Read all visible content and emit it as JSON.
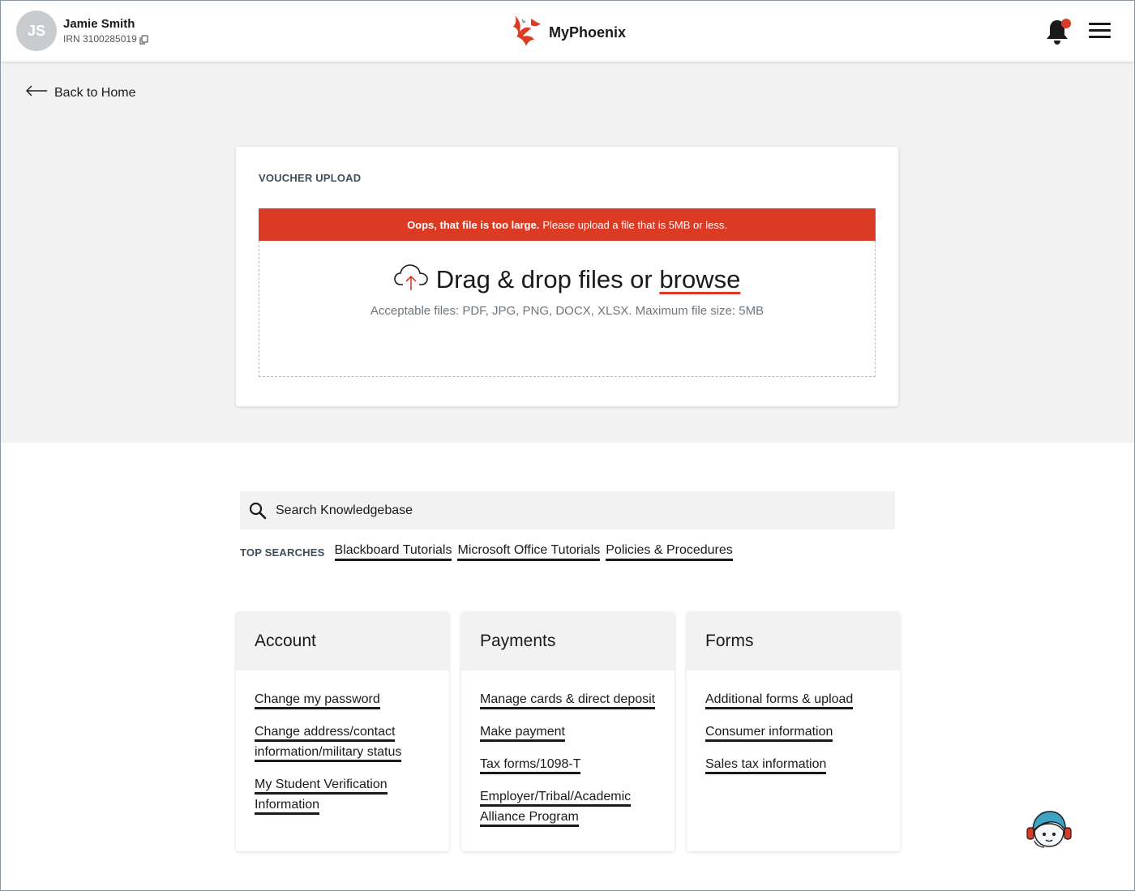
{
  "header": {
    "avatar_initials": "JS",
    "user_name": "Jamie Smith",
    "irn": "IRN 3100285019",
    "brand": "MyPhoenix",
    "notification_badge_color": "#db3a25"
  },
  "nav": {
    "back_label": "Back to Home"
  },
  "upload": {
    "title": "VOUCHER UPLOAD",
    "error_bold": "Oops, that file is too large.",
    "error_rest": "Please upload a file that is 5MB or less.",
    "drop_text": "Drag & drop files or",
    "browse_label": "browse",
    "accept_text": "Acceptable files: PDF, JPG, PNG, DOCX, XLSX. Maximum file size: 5MB",
    "error_color": "#db3a25"
  },
  "search": {
    "placeholder": "Search Knowledgebase",
    "top_label": "TOP SEARCHES",
    "top_searches": [
      "Blackboard Tutorials",
      "Microsoft Office Tutorials",
      "Policies & Procedures"
    ]
  },
  "categories": [
    {
      "title": "Account",
      "links": [
        "Change my password",
        "Change address/contact information/military status",
        "My Student Verification Information"
      ]
    },
    {
      "title": "Payments",
      "links": [
        "Manage cards & direct deposit",
        "Make payment",
        "Tax forms/1098-T",
        "Employer/Tribal/Academic Alliance Program"
      ]
    },
    {
      "title": "Forms",
      "links": [
        "Additional forms & upload",
        "Consumer information",
        "Sales tax information"
      ]
    }
  ],
  "icons": [
    "copy-icon",
    "phoenix-logo-icon",
    "bell-icon",
    "menu-icon",
    "arrow-left-icon",
    "cloud-upload-icon",
    "search-icon",
    "chat-bot-icon"
  ]
}
